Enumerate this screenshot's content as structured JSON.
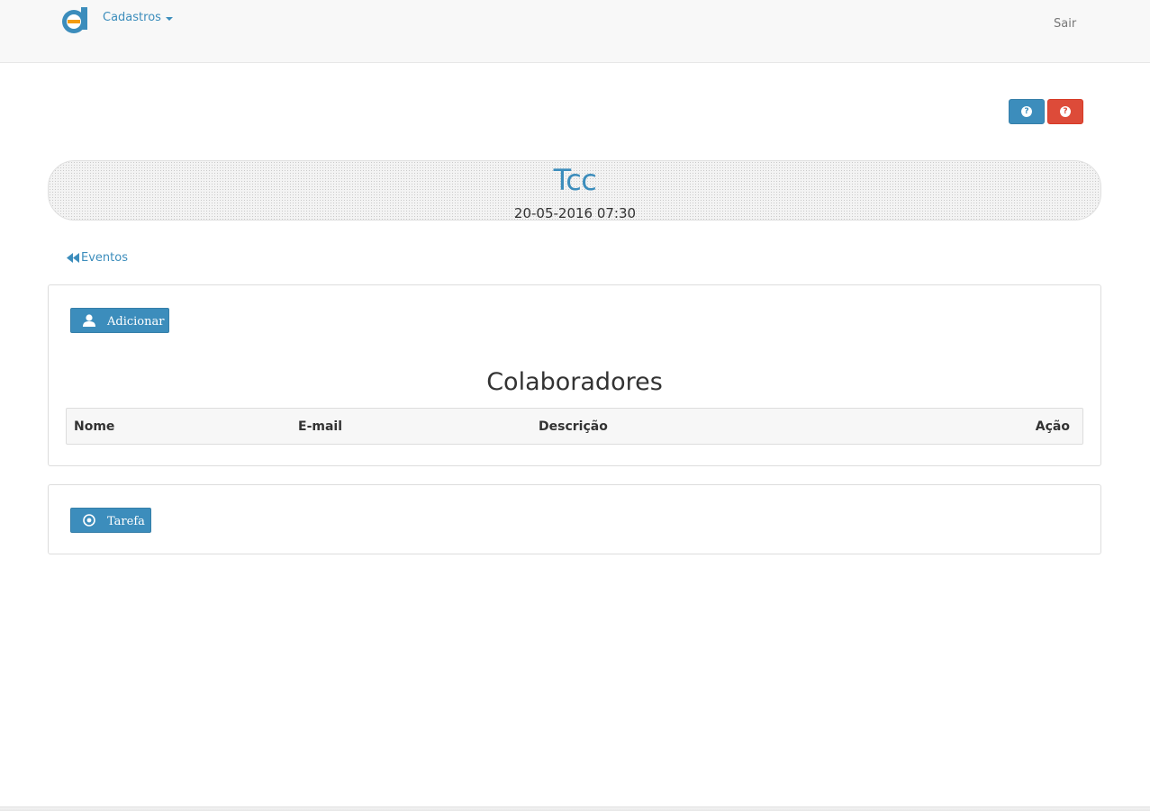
{
  "navbar": {
    "logo_icon": "app-logo-icon",
    "menu_label": "Cadastros",
    "logout_label": "Sair"
  },
  "help_buttons": [
    {
      "icon": "question-circle-icon",
      "color": "#3c8dbc"
    },
    {
      "icon": "question-circle-icon",
      "color": "#dd4b39"
    }
  ],
  "event": {
    "title": "Tcc",
    "datetime": "20-05-2016 07:30"
  },
  "back_link": {
    "icon": "double-chevron-left-icon",
    "label": "Eventos"
  },
  "collaborators_panel": {
    "add_button": {
      "icon": "user-icon",
      "label": "Adicionar"
    },
    "title": "Colaboradores",
    "columns": [
      "Nome",
      "E-mail",
      "Descrição",
      "Ação"
    ]
  },
  "tasks_panel": {
    "task_button": {
      "icon": "target-icon",
      "label": "Tarefa"
    }
  },
  "colors": {
    "primary": "#3c8dbc",
    "danger": "#dd4b39",
    "logo_ring": "#3c8dbc",
    "logo_accent": "#f39c12"
  }
}
